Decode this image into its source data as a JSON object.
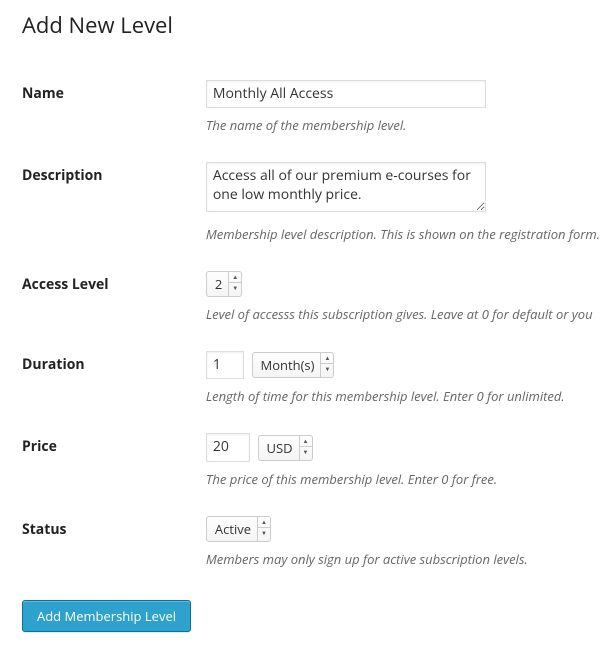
{
  "page_title": "Add New Level",
  "fields": {
    "name": {
      "label": "Name",
      "value": "Monthly All Access",
      "desc": "The name of the membership level."
    },
    "description": {
      "label": "Description",
      "value": "Access all of our premium e-courses for one low monthly price.",
      "desc": "Membership level description. This is shown on the registration form."
    },
    "access_level": {
      "label": "Access Level",
      "value": "2",
      "desc": "Level of accesss this subscription gives. Leave at 0 for default or you"
    },
    "duration": {
      "label": "Duration",
      "value": "1",
      "unit": "Month(s)",
      "desc": "Length of time for this membership level. Enter 0 for unlimited."
    },
    "price": {
      "label": "Price",
      "value": "20",
      "currency": "USD",
      "desc": "The price of this membership level. Enter 0 for free."
    },
    "status": {
      "label": "Status",
      "value": "Active",
      "desc": "Members may only sign up for active subscription levels."
    }
  },
  "submit_label": "Add Membership Level"
}
